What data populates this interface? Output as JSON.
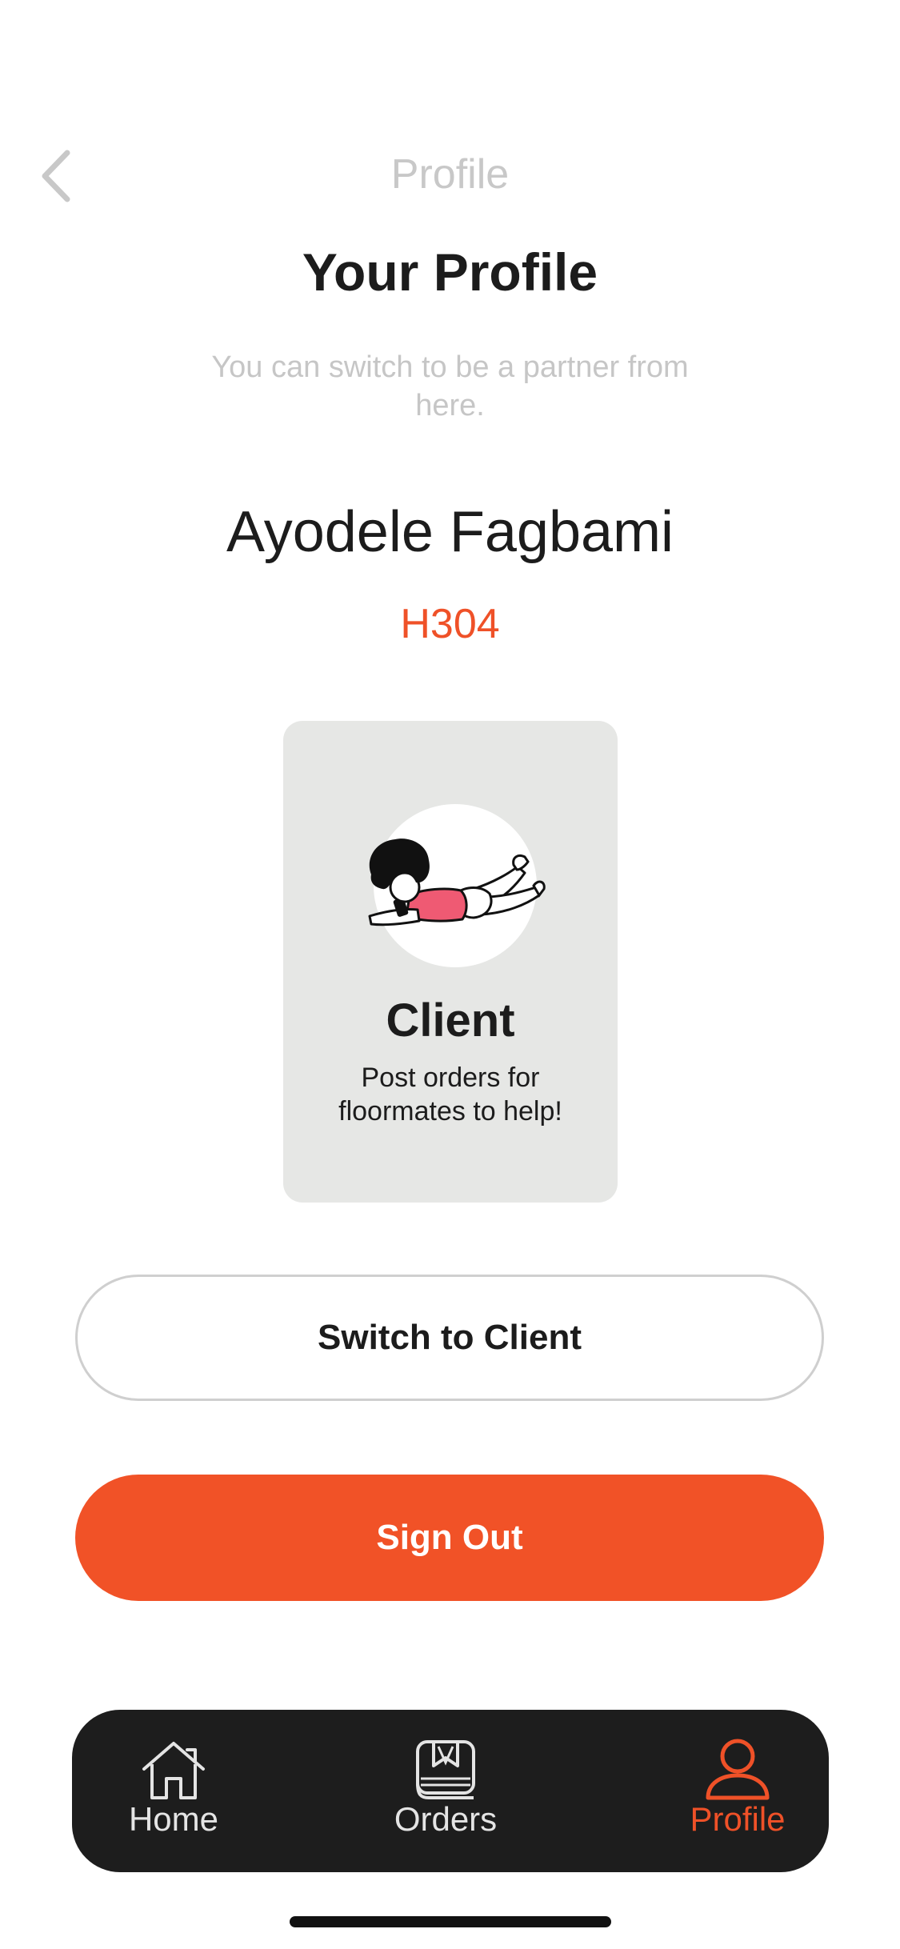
{
  "header": {
    "nav_title": "Profile",
    "page_title": "Your Profile",
    "subtitle": "You can switch to be a partner from here."
  },
  "user": {
    "name": "Ayodele Fagbami",
    "room": "H304"
  },
  "role_card": {
    "title": "Client",
    "description": "Post orders for floormates to help!",
    "illustration": "person-lying-with-phone-illustration"
  },
  "buttons": {
    "switch_label": "Switch to Client",
    "signout_label": "Sign Out"
  },
  "tab_bar": {
    "items": [
      {
        "label": "Home",
        "icon": "home-icon",
        "active": false
      },
      {
        "label": "Orders",
        "icon": "orders-icon",
        "active": false
      },
      {
        "label": "Profile",
        "icon": "profile-icon",
        "active": true
      }
    ]
  },
  "colors": {
    "accent": "#F15227",
    "card_bg": "#E6E7E5",
    "tab_bar_bg": "#1D1D1D",
    "muted_text": "#C6C6C6"
  }
}
